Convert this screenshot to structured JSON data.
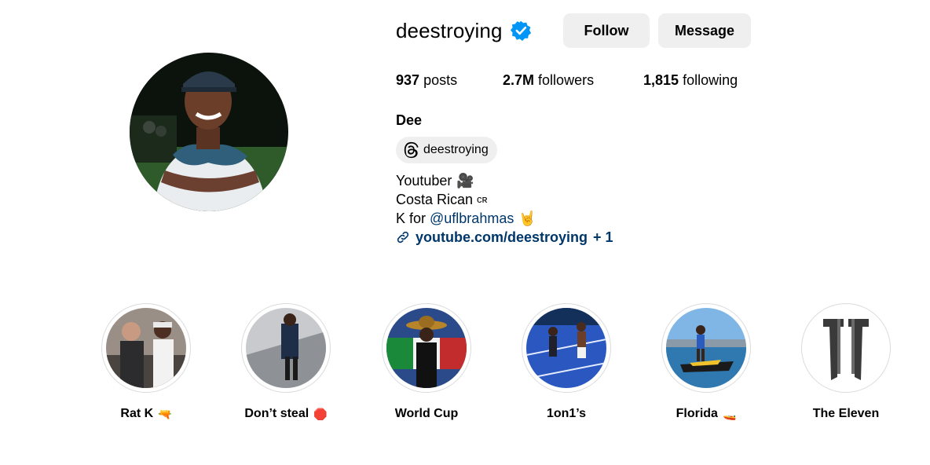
{
  "profile": {
    "username": "deestroying",
    "verified_icon": "verified-badge-icon",
    "follow_label": "Follow",
    "message_label": "Message",
    "stats": {
      "posts_count": "937",
      "posts_label": "posts",
      "followers_count": "2.7M",
      "followers_label": "followers",
      "following_count": "1,815",
      "following_label": "following"
    },
    "full_name": "Dee",
    "threads_handle": "deestroying",
    "bio": {
      "line1": "Youtuber",
      "line1_emoji": "🎥",
      "line2": "Costa Rican",
      "line2_suffix": "ᴄʀ",
      "line3_prefix": "K for",
      "line3_mention": "@uflbrahmas",
      "line3_emoji": "🤘",
      "link_text": "youtube.com/deestroying",
      "link_more": "+ 1"
    }
  },
  "highlights": [
    {
      "label": "Rat K",
      "emoji": "🔫"
    },
    {
      "label": "Don’t steal",
      "emoji": "🛑"
    },
    {
      "label": "World Cup",
      "emoji": ""
    },
    {
      "label": "1on1’s",
      "emoji": ""
    },
    {
      "label": "Florida",
      "emoji": "🚤"
    },
    {
      "label": "The Eleven",
      "emoji": ""
    }
  ],
  "colors": {
    "button_bg": "#efefef",
    "link": "#00376b",
    "verified": "#0095f6",
    "ring": "#dbdbdb"
  }
}
